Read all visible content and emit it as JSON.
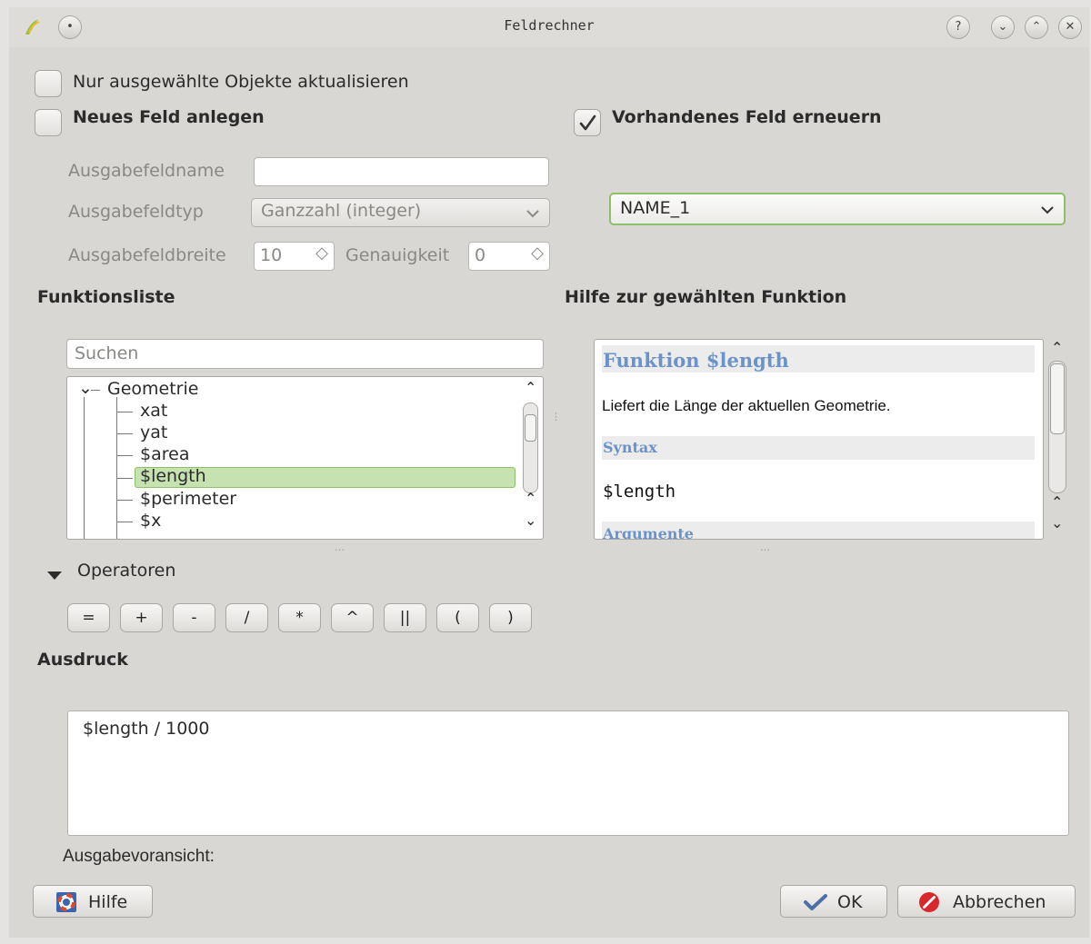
{
  "window": {
    "title": "Feldrechner"
  },
  "options": {
    "only_selected": "Nur ausgewählte Objekte aktualisieren",
    "new_field": "Neues Feld anlegen",
    "update_existing": "Vorhandenes Feld erneuern"
  },
  "new_field_form": {
    "name_label": "Ausgabefeldname",
    "name_value": "",
    "type_label": "Ausgabefeldtyp",
    "type_value": "Ganzzahl (integer)",
    "width_label": "Ausgabefeldbreite",
    "width_value": "10",
    "precision_label": "Genauigkeit",
    "precision_value": "0"
  },
  "existing_field": {
    "selected": "NAME_1"
  },
  "function_list": {
    "heading": "Funktionsliste",
    "search_placeholder": "Suchen",
    "group": "Geometrie",
    "items": [
      "xat",
      "yat",
      "$area",
      "$length",
      "$perimeter",
      "$x"
    ],
    "selected": "$length"
  },
  "help": {
    "heading": "Hilfe zur gewählten Funktion",
    "func_title": "Funktion $length",
    "description": "Liefert die Länge der aktuellen Geometrie.",
    "syntax_label": "Syntax",
    "syntax": "$length",
    "args_label": "Argumente"
  },
  "operators": {
    "label": "Operatoren",
    "buttons": [
      "=",
      "+",
      "-",
      "/",
      "*",
      "^",
      "||",
      "(",
      ")"
    ]
  },
  "expression": {
    "heading": "Ausdruck",
    "value": "$length / 1000",
    "preview_label": "Ausgabevoransicht:"
  },
  "buttons": {
    "help": "Hilfe",
    "ok": "OK",
    "cancel": "Abbrechen"
  },
  "icons": {
    "app": "qgis-icon",
    "menu": "window-menu-icon",
    "help": "question-icon",
    "minimize": "minimize-icon",
    "maximize": "maximize-icon",
    "close": "close-icon",
    "ok": "checkmark-icon",
    "cancel": "cancel-icon",
    "lifebuoy": "lifebuoy-icon"
  }
}
